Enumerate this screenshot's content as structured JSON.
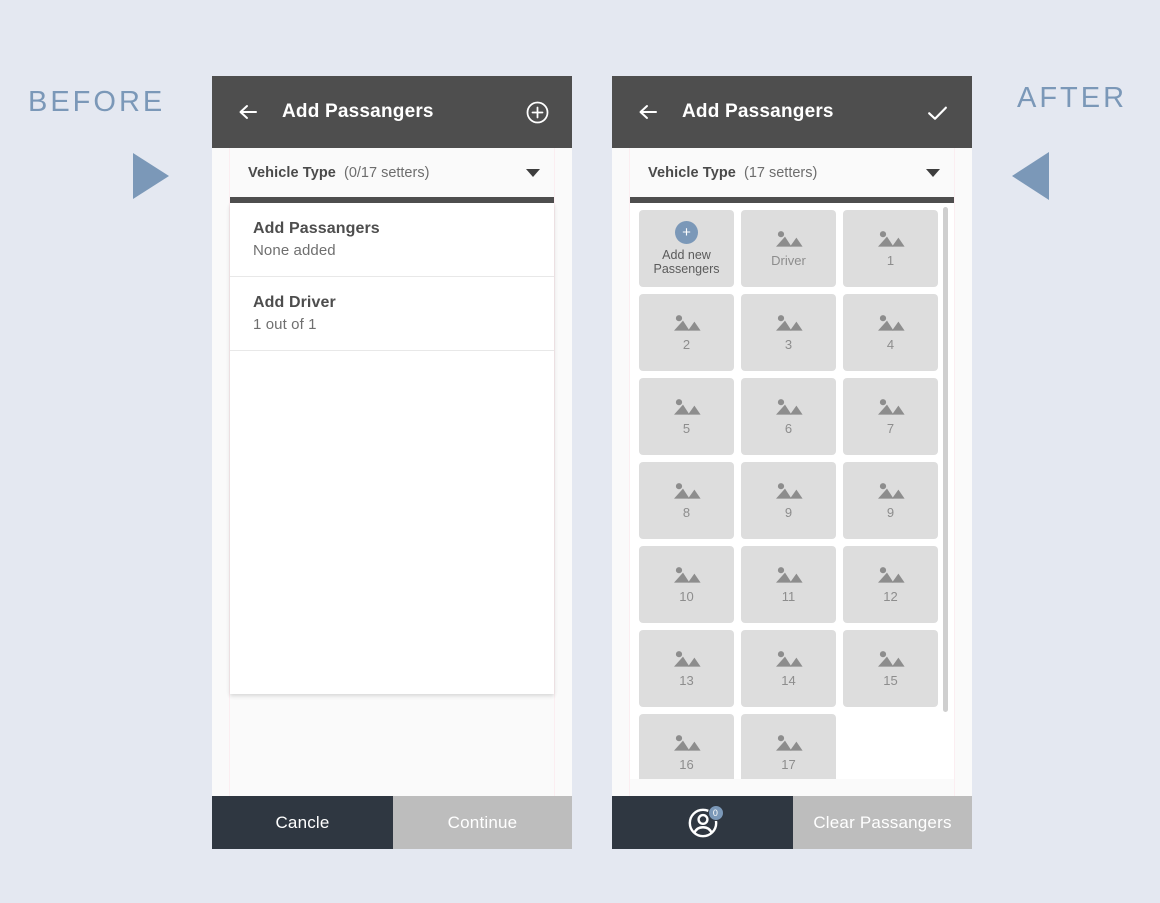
{
  "page": {
    "background": "#e4e8f1",
    "accent": "#7b98b8",
    "appbar_color": "#4e4e4e",
    "action_primary_color": "#2f3741",
    "action_secondary_color": "#bdbdbd",
    "tile_color": "#dddddd"
  },
  "annotations": {
    "before_label": "BEFORE",
    "after_label": "AFTER",
    "before_arrow_icon": "play-triangle-right-icon",
    "after_arrow_icon": "play-triangle-left-icon"
  },
  "before_screen": {
    "appbar": {
      "back_icon": "arrow-left-icon",
      "title": "Add Passangers",
      "action_icon": "plus-circle-icon"
    },
    "dropdown": {
      "label": "Vehicle Type",
      "value": "(0/17 setters)",
      "caret_icon": "chevron-down-icon"
    },
    "list": [
      {
        "title": "Add Passangers",
        "subtitle": "None added"
      },
      {
        "title": "Add Driver",
        "subtitle": "1 out of 1"
      }
    ],
    "actions": {
      "primary": "Cancle",
      "secondary": "Continue"
    }
  },
  "after_screen": {
    "appbar": {
      "back_icon": "arrow-left-icon",
      "title": "Add Passangers",
      "action_icon": "check-icon"
    },
    "dropdown": {
      "label": "Vehicle Type",
      "value": "(17 setters)",
      "caret_icon": "chevron-down-icon"
    },
    "grid": {
      "add_tile": {
        "icon": "plus-circle-icon",
        "plus_glyph": "+",
        "label_line1": "Add new",
        "label_line2": "Passengers"
      },
      "tiles": [
        {
          "label": "Driver",
          "icon": "image-placeholder-icon"
        },
        {
          "label": "1",
          "icon": "image-placeholder-icon"
        },
        {
          "label": "2",
          "icon": "image-placeholder-icon"
        },
        {
          "label": "3",
          "icon": "image-placeholder-icon"
        },
        {
          "label": "4",
          "icon": "image-placeholder-icon"
        },
        {
          "label": "5",
          "icon": "image-placeholder-icon"
        },
        {
          "label": "6",
          "icon": "image-placeholder-icon"
        },
        {
          "label": "7",
          "icon": "image-placeholder-icon"
        },
        {
          "label": "8",
          "icon": "image-placeholder-icon"
        },
        {
          "label": "9",
          "icon": "image-placeholder-icon"
        },
        {
          "label": "9",
          "icon": "image-placeholder-icon"
        },
        {
          "label": "10",
          "icon": "image-placeholder-icon"
        },
        {
          "label": "11",
          "icon": "image-placeholder-icon"
        },
        {
          "label": "12",
          "icon": "image-placeholder-icon"
        },
        {
          "label": "13",
          "icon": "image-placeholder-icon"
        },
        {
          "label": "14",
          "icon": "image-placeholder-icon"
        },
        {
          "label": "15",
          "icon": "image-placeholder-icon"
        },
        {
          "label": "16",
          "icon": "image-placeholder-icon"
        },
        {
          "label": "17",
          "icon": "image-placeholder-icon"
        }
      ]
    },
    "actions": {
      "primary_icon": "user-account-icon",
      "primary_badge": "0",
      "secondary": "Clear Passangers"
    }
  }
}
